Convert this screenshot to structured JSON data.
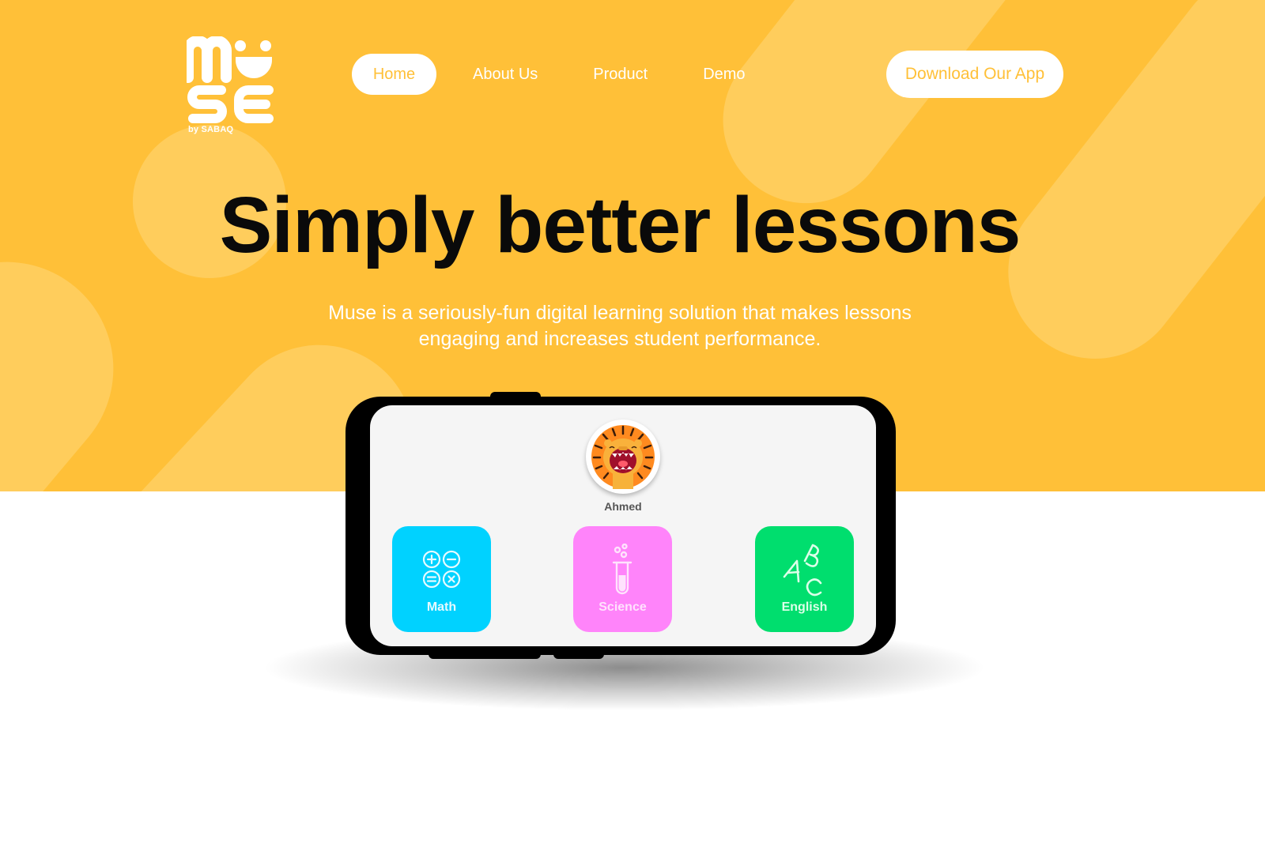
{
  "brand": {
    "logo_text": "MUSE",
    "byline": "by SABAQ",
    "colors": {
      "primary_yellow": "#ffc038",
      "math": "#00d2ff",
      "science": "#ff84fa",
      "english": "#00de6e"
    }
  },
  "nav": {
    "items": [
      {
        "label": "Home",
        "active": true
      },
      {
        "label": "About Us",
        "active": false
      },
      {
        "label": "Product",
        "active": false
      },
      {
        "label": "Demo",
        "active": false
      }
    ],
    "cta_label": "Download Our App"
  },
  "hero": {
    "headline": "Simply better lessons",
    "subtitle_line1": "Muse is a seriously-fun digital learning solution that makes lessons",
    "subtitle_line2": "engaging and increases student performance."
  },
  "app_preview": {
    "user": {
      "name": "Ahmed",
      "avatar_icon": "lion-icon"
    },
    "subjects": [
      {
        "label": "Math",
        "icon": "math-operators-icon"
      },
      {
        "label": "Science",
        "icon": "test-tube-icon"
      },
      {
        "label": "English",
        "icon": "abc-letters-icon"
      }
    ]
  }
}
